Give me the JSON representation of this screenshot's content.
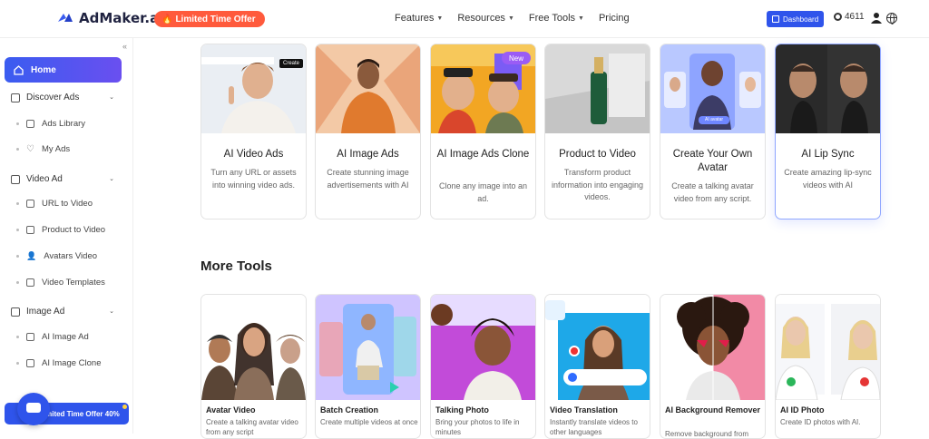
{
  "header": {
    "logo_text": "AdMaker.ai",
    "offer_label": "Limited Time Offer",
    "nav": [
      "Features",
      "Resources",
      "Free Tools",
      "Pricing"
    ],
    "dashboard_label": "Dashboard",
    "credits": "4611"
  },
  "sidebar": {
    "home": "Home",
    "sections": [
      {
        "label": "Discover Ads",
        "items": [
          "Ads Library",
          "My Ads"
        ]
      },
      {
        "label": "Video Ad",
        "items": [
          "URL to Video",
          "Product to Video",
          "Avatars Video",
          "Video Templates"
        ]
      },
      {
        "label": "Image Ad",
        "items": [
          "AI Image Ad",
          "AI Image Clone"
        ]
      }
    ],
    "offer_bar": "Limited Time Offer 40%"
  },
  "cards": [
    {
      "title": "AI Video Ads",
      "desc": "Turn any URL or assets into winning video ads.",
      "badge": "Create"
    },
    {
      "title": "AI Image Ads",
      "desc": "Create stunning image advertisements with AI"
    },
    {
      "title": "AI Image Ads Clone",
      "desc": "Clone any image into an ad.",
      "badge": "New"
    },
    {
      "title": "Product to Video",
      "desc": "Transform product information into engaging videos."
    },
    {
      "title": "Create Your Own Avatar",
      "desc": "Create a talking avatar video from any script.",
      "image_label": "AI avatar"
    },
    {
      "title": "AI Lip Sync",
      "desc": "Create amazing lip-sync videos with AI"
    }
  ],
  "more_tools_title": "More Tools",
  "tools": [
    {
      "title": "Avatar Video",
      "desc": "Create a talking avatar video from any script"
    },
    {
      "title": "Batch Creation",
      "desc": "Create multiple videos at once"
    },
    {
      "title": "Talking Photo",
      "desc": "Bring your photos to life in minutes"
    },
    {
      "title": "Video Translation",
      "desc": "Instantly translate videos to other languages"
    },
    {
      "title": "AI Background Remover",
      "desc": "Remove background from"
    },
    {
      "title": "AI ID Photo",
      "desc": "Create ID photos with AI."
    }
  ],
  "colors": {
    "accent": "#2f54eb",
    "offer": "#ff5a3c",
    "badge_new": "#9a5cf5"
  }
}
